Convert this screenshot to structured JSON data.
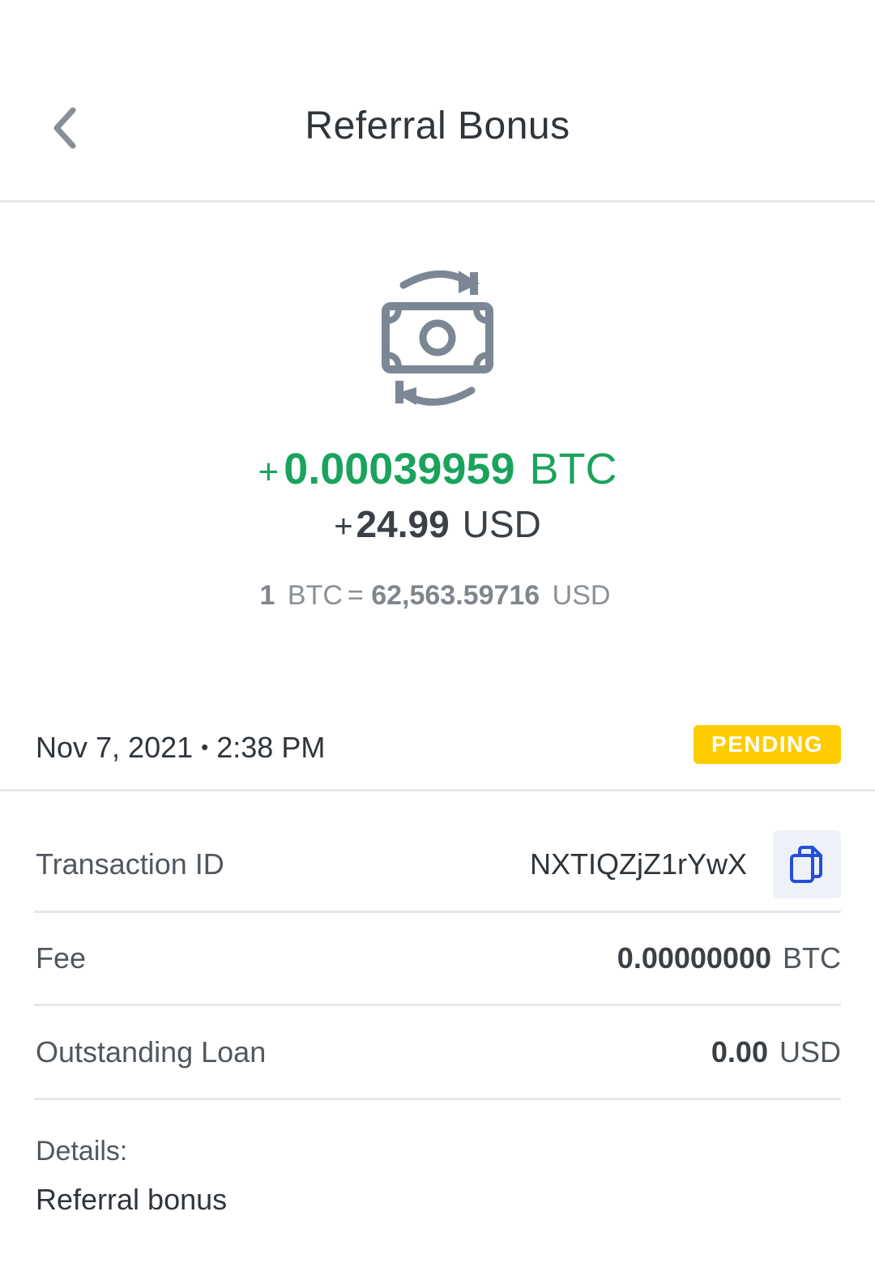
{
  "header": {
    "title": "Referral Bonus",
    "back_icon": "chevron-left-icon"
  },
  "hero": {
    "icon": "money-exchange-icon",
    "icon_color": "#7b8794",
    "btc_sign": "+",
    "btc_amount": "0.00039959",
    "btc_unit": "BTC",
    "usd_sign": "+",
    "usd_amount": "24.99",
    "usd_unit": "USD",
    "rate_qty": "1",
    "rate_from_unit": "BTC",
    "rate_equals": "=",
    "rate_value": "62,563.59716",
    "rate_to_unit": "USD",
    "positive_color": "#1aa35c"
  },
  "status": {
    "date": "Nov 7, 2021",
    "separator": "•",
    "time": "2:38 PM",
    "badge": "PENDING",
    "badge_color": "#ffcc00"
  },
  "details_rows": {
    "txid": {
      "label": "Transaction ID",
      "value": "NXTIQZjZ1rYwX",
      "copy_icon": "copy-icon"
    },
    "fee": {
      "label": "Fee",
      "value": "0.00000000",
      "unit": "BTC"
    },
    "loan": {
      "label": "Outstanding Loan",
      "value": "0.00",
      "unit": "USD"
    }
  },
  "notes": {
    "label": "Details:",
    "text": "Referral bonus"
  }
}
